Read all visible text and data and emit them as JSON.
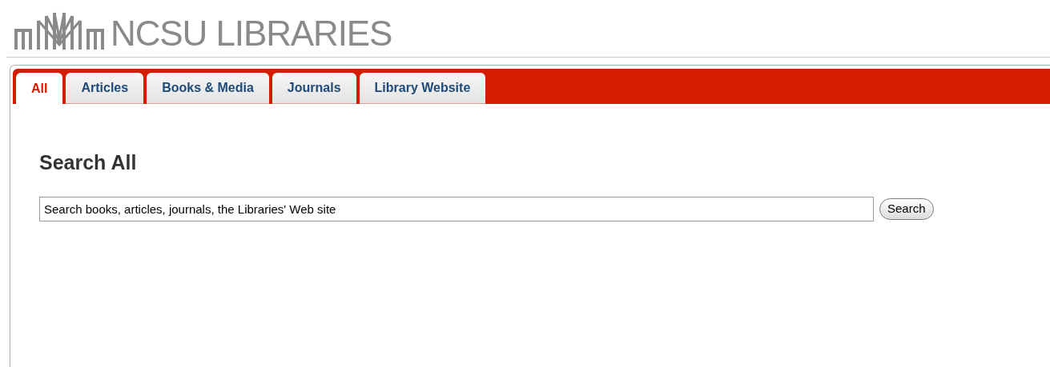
{
  "header": {
    "logo_text": "NCSU LIBRARIES"
  },
  "tabs": [
    {
      "label": "All",
      "selected": true
    },
    {
      "label": "Articles",
      "selected": false
    },
    {
      "label": "Books & Media",
      "selected": false
    },
    {
      "label": "Journals",
      "selected": false
    },
    {
      "label": "Library Website",
      "selected": false
    }
  ],
  "search": {
    "heading": "Search All",
    "value": "Search books, articles, journals, the Libraries' Web site",
    "button": "Search"
  }
}
